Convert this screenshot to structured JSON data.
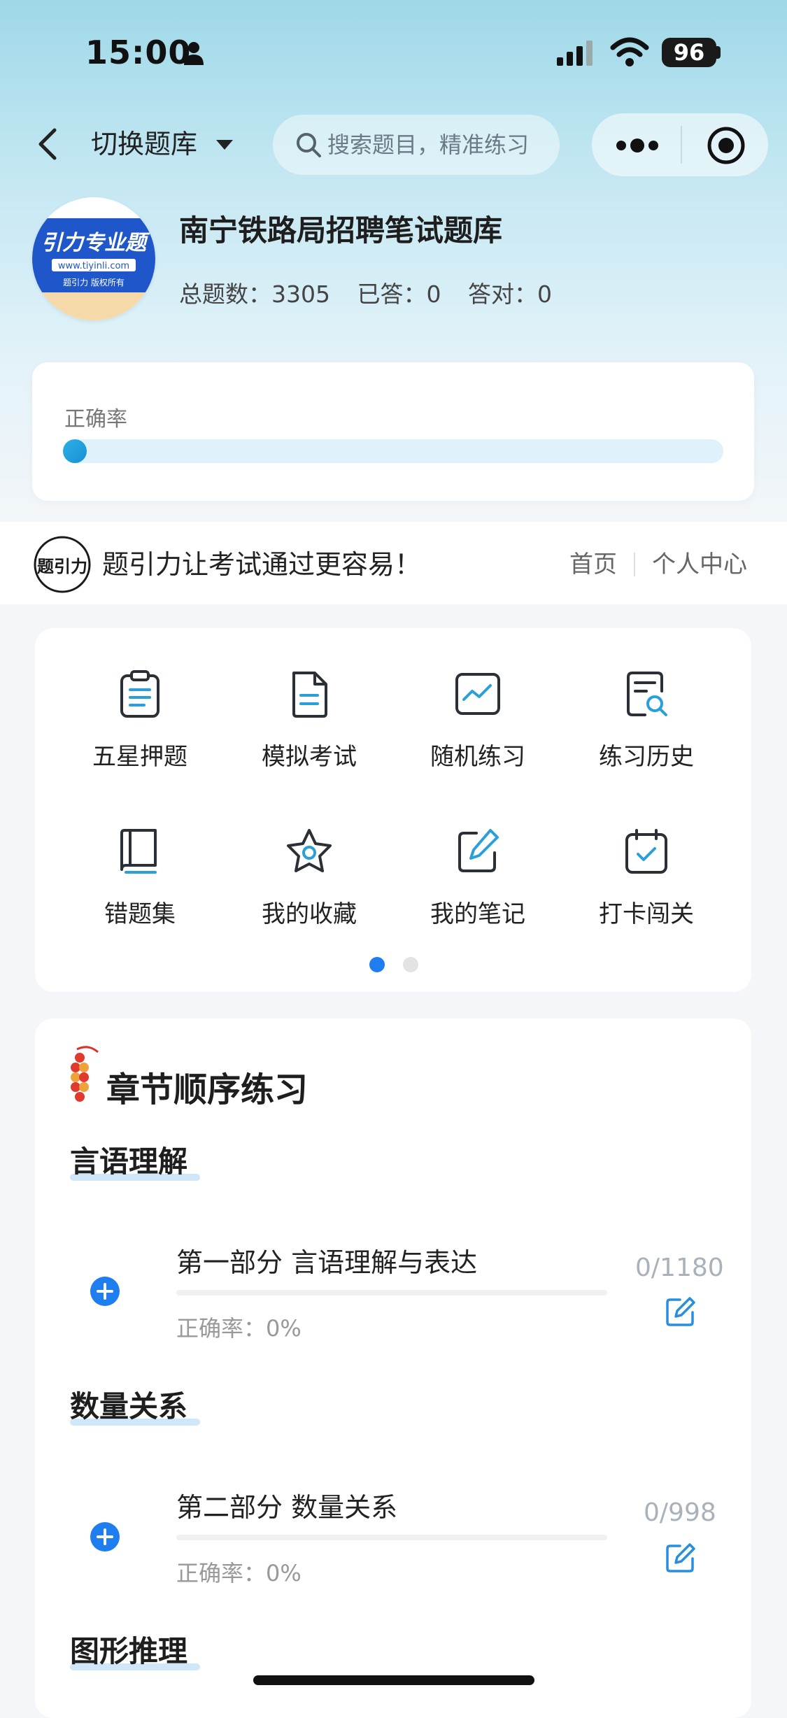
{
  "status_bar": {
    "time": "15:00",
    "battery": "96"
  },
  "nav": {
    "switch_label": "切换题库",
    "search_placeholder": "搜索题目，精准练习"
  },
  "bank": {
    "logo_text": "引力专业题",
    "logo_url": "www.tiyinli.com",
    "logo_footer": "题引力 版权所有",
    "title": "南宁铁路局招聘笔试题库",
    "stats": {
      "total": "总题数：3305",
      "answered": "已答：0",
      "correct": "答对：0"
    }
  },
  "accuracy": {
    "label": "正确率",
    "value": 0
  },
  "promo": {
    "logo_text": "题引力",
    "text": "题引力让考试通过更容易！",
    "home": "首页",
    "center": "个人中心"
  },
  "grid": {
    "items": [
      {
        "label": "五星押题",
        "icon": "clipboard-icon"
      },
      {
        "label": "模拟考试",
        "icon": "document-icon"
      },
      {
        "label": "随机练习",
        "icon": "chart-icon"
      },
      {
        "label": "练习历史",
        "icon": "history-search-icon"
      },
      {
        "label": "错题集",
        "icon": "book-icon"
      },
      {
        "label": "我的收藏",
        "icon": "star-icon"
      },
      {
        "label": "我的笔记",
        "icon": "note-edit-icon"
      },
      {
        "label": "打卡闯关",
        "icon": "calendar-check-icon"
      }
    ],
    "page_count": 2,
    "current_page": 1
  },
  "chapters": {
    "title": "章节顺序练习",
    "sections": [
      {
        "title": "言语理解",
        "chapter": {
          "name": "第一部分 言语理解与表达",
          "accuracy": "正确率：0%",
          "count": "0/1180"
        }
      },
      {
        "title": "数量关系",
        "chapter": {
          "name": "第二部分 数量关系",
          "accuracy": "正确率：0%",
          "count": "0/998"
        }
      },
      {
        "title": "图形推理"
      }
    ]
  },
  "colors": {
    "accent": "#1e7ef0",
    "icon_blue": "#2a9fd8",
    "icon_dark": "#2b2f36"
  }
}
